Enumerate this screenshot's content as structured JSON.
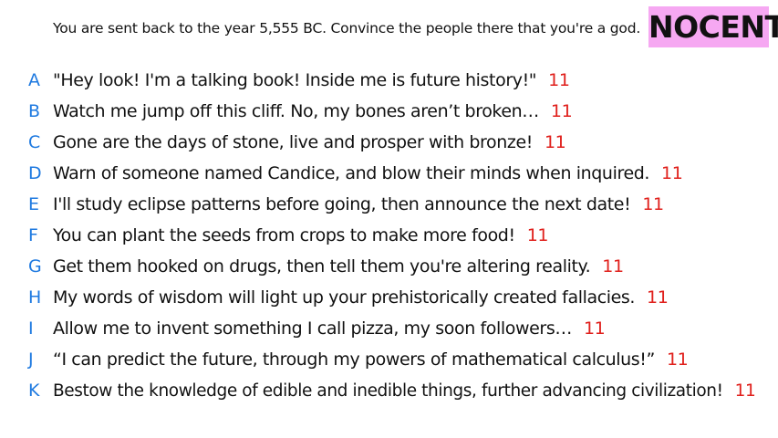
{
  "prompt": "You are sent back to the year 5,555 BC. Convince the people there that you're a god.",
  "badge": "NOCENT",
  "colors": {
    "letter": "#1f7ae0",
    "score": "#e0201c",
    "badge_bg": "#f6a8f2"
  },
  "answers": [
    {
      "letter": "A",
      "text": "\"Hey look! I'm a talking book! Inside me is future history!\"",
      "score": "11"
    },
    {
      "letter": "B",
      "text": "Watch me jump off this cliff. No, my bones aren’t broken…",
      "score": "11"
    },
    {
      "letter": "C",
      "text": "Gone are the days of stone, live and prosper with bronze!",
      "score": "11"
    },
    {
      "letter": "D",
      "text": "Warn of someone named Candice, and blow their minds when inquired.",
      "score": "11"
    },
    {
      "letter": "E",
      "text": "I'll study eclipse patterns before going, then announce the next date!",
      "score": "11"
    },
    {
      "letter": "F",
      "text": "You can plant the seeds from crops to make more food!",
      "score": "11"
    },
    {
      "letter": "G",
      "text": "Get them hooked on drugs, then tell them you're altering reality.",
      "score": "11"
    },
    {
      "letter": "H",
      "text": "My words of wisdom will light up your prehistorically created fallacies.",
      "score": "11"
    },
    {
      "letter": "I",
      "text": "Allow me to invent something I call pizza, my soon followers…",
      "score": "11"
    },
    {
      "letter": "J",
      "text": "“I can predict the future, through my powers of mathematical calculus!”",
      "score": "11"
    },
    {
      "letter": "K",
      "text": "Bestow the knowledge of edible and inedible things, further advancing civilization!",
      "score": "11"
    }
  ]
}
